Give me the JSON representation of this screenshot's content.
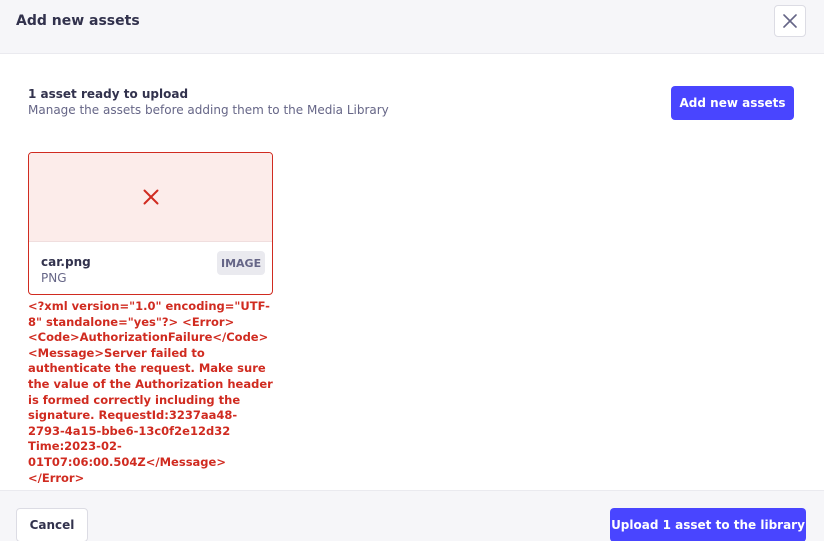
{
  "header": {
    "title": "Add new assets",
    "close_icon": "close-icon"
  },
  "summary": {
    "title": "1 asset ready to upload",
    "subtitle": "Manage the assets before adding them to the Media Library",
    "add_button_label": "Add new assets"
  },
  "asset": {
    "name": "car.png",
    "extension": "PNG",
    "type_badge": "IMAGE",
    "status_icon": "error-x-icon",
    "error_message": "<?xml version=\"1.0\" encoding=\"UTF-8\" standalone=\"yes\"?> <Error><Code>AuthorizationFailure</Code><Message>Server failed to authenticate the request. Make sure the value of the Authorization header is formed correctly including the signature. RequestId:3237aa48-2793-4a15-bbe6-13c0f2e12d32 Time:2023-02-01T07:06:00.504Z</Message> </Error>"
  },
  "footer": {
    "cancel_label": "Cancel",
    "upload_label": "Upload 1 asset to the library"
  },
  "colors": {
    "primary": "#4945ff",
    "danger": "#d02b20",
    "danger_bg": "#fcecea",
    "header_bg": "#f6f6f9"
  }
}
